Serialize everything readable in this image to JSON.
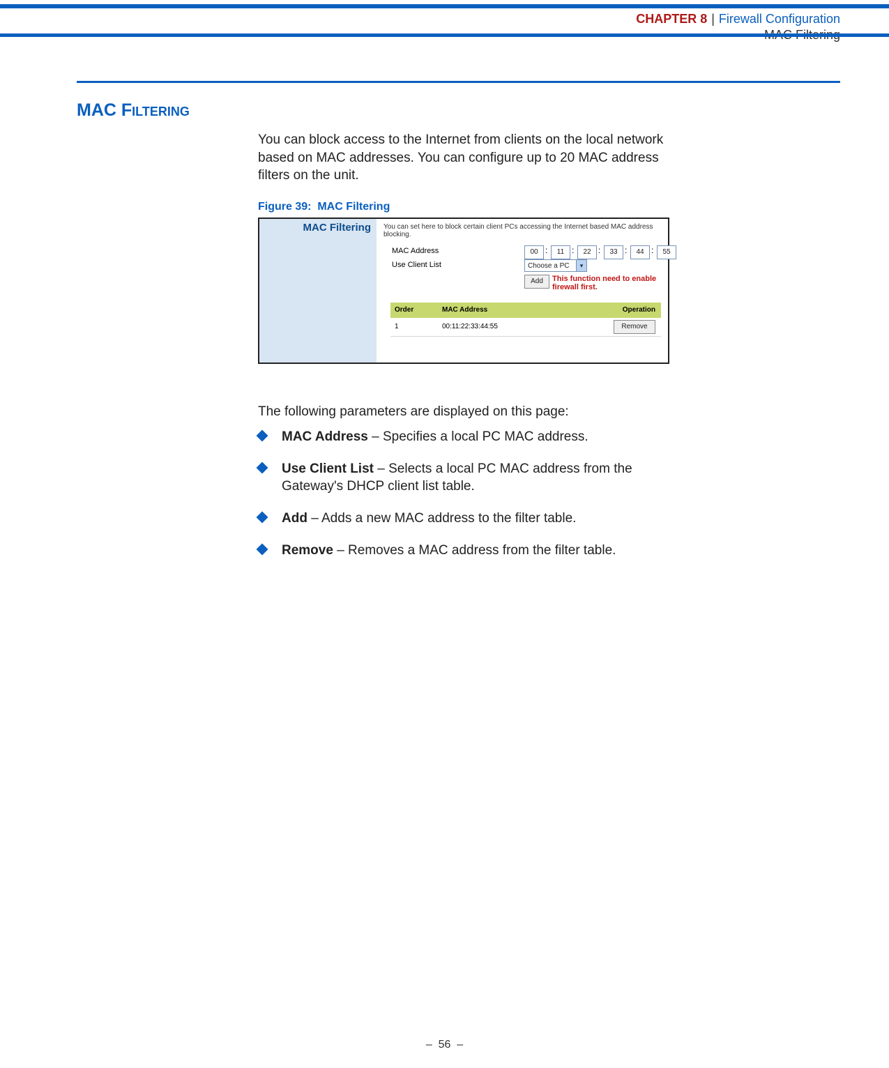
{
  "header": {
    "chapter_label": "CHAPTER 8",
    "chapter_title": "Firewall Configuration",
    "subtitle": "MAC Filtering"
  },
  "section": {
    "title_word1": "MAC",
    "title_word2": "Filtering",
    "intro": "You can block access to the Internet from clients on the local network based on MAC addresses. You can configure up to 20 MAC address filters on the unit.",
    "figure_caption": "Figure 39:  MAC Filtering"
  },
  "screenshot": {
    "side_title": "MAC Filtering",
    "desc": "You can set here to block certain client PCs accessing the Internet based MAC address blocking.",
    "label_mac": "MAC Address",
    "label_client": "Use Client List",
    "octets": [
      "00",
      "11",
      "22",
      "33",
      "44",
      "55"
    ],
    "select_text": "Choose a PC",
    "add_label": "Add",
    "warn": "This function need to enable firewall first.",
    "th_order": "Order",
    "th_mac": "MAC Address",
    "th_op": "Operation",
    "row_order": "1",
    "row_mac": "00:11:22:33:44:55",
    "remove_label": "Remove"
  },
  "params_lead": "The following parameters are displayed on this page:",
  "bullets": [
    {
      "term": "MAC Address",
      "desc": " – Specifies a local PC MAC address."
    },
    {
      "term": "Use Client List",
      "desc": " – Selects a local PC MAC address from the Gateway's DHCP client list table."
    },
    {
      "term": "Add",
      "desc": " – Adds a new MAC address to the filter table."
    },
    {
      "term": "Remove",
      "desc": " – Removes a MAC address from the filter table."
    }
  ],
  "footer": "–  56  –"
}
